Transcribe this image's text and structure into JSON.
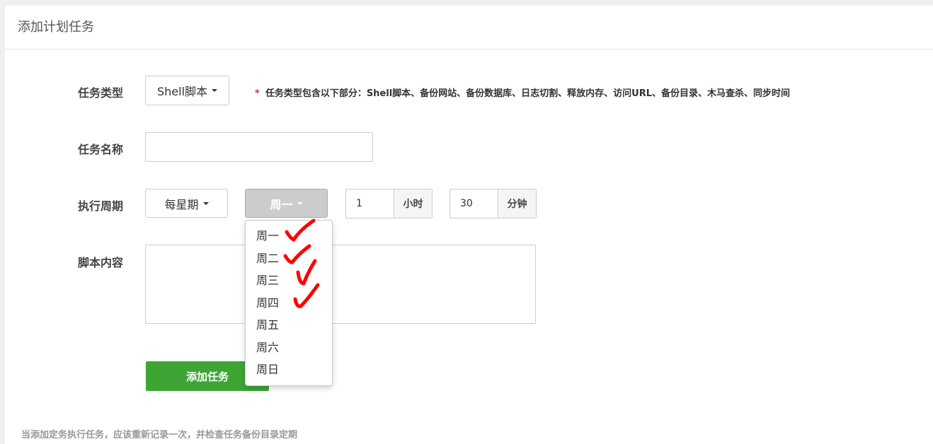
{
  "panel": {
    "title": "添加计划任务"
  },
  "form": {
    "task_type": {
      "label": "任务类型",
      "value": "Shell脚本",
      "note_star": "*",
      "note": "任务类型包含以下部分：Shell脚本、备份网站、备份数据库、日志切割、释放内存、访问URL、备份目录、木马查杀、同步时间"
    },
    "task_name": {
      "label": "任务名称",
      "value": "",
      "placeholder": ""
    },
    "cycle": {
      "label": "执行周期",
      "period": "每星期",
      "weekday": "周一",
      "hour_value": "1",
      "hour_unit": "小时",
      "minute_value": "30",
      "minute_unit": "分钟"
    },
    "script": {
      "label": "脚本内容",
      "value": ""
    },
    "submit_label": "添加任务"
  },
  "weekday_dropdown": {
    "items": [
      "周一",
      "周二",
      "周三",
      "周四",
      "周五",
      "周六",
      "周日"
    ],
    "annotated_checked": [
      "周一",
      "周二",
      "周三",
      "周四"
    ],
    "check_color": "#ff0000"
  },
  "footer": {
    "text": "当添加定务执行任务，应该重新记录一次，并检查任务备份目录定期"
  }
}
